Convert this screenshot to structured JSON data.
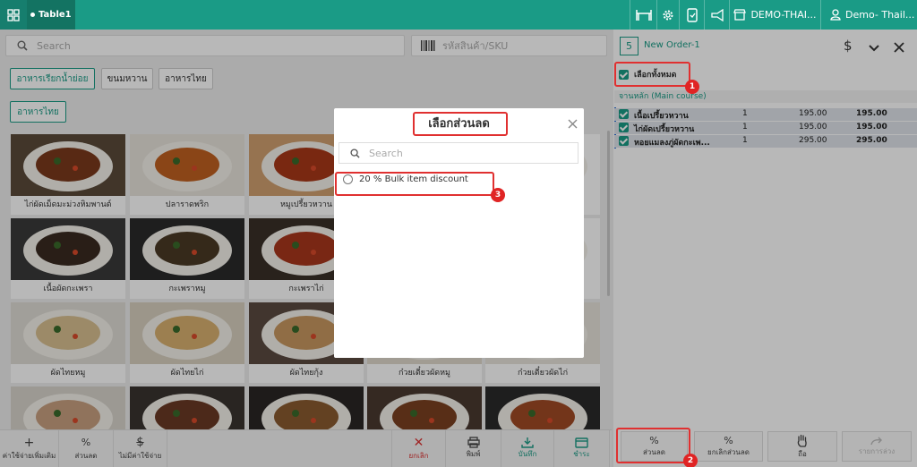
{
  "topbar": {
    "table_tab": "Table1",
    "branch": "DEMO-THAI...",
    "user": "Demo- Thail..."
  },
  "search": {
    "placeholder": "Search"
  },
  "sku": {
    "placeholder": "รหัสสินค้า/SKU"
  },
  "categories": [
    "อาหารเรียกน้ำย่อย",
    "ขนมหวาน",
    "อาหารไทย",
    "อาหารไทย"
  ],
  "products": [
    "ไก่ผัดเม็ดมะม่วงหิมพานต์",
    "ปลาราดพริก",
    "หมูเปรี้ยวหวาน",
    "",
    "",
    "เนื้อผัดกะเพรา",
    "กะเพราหมู",
    "กะเพราไก่",
    "",
    "",
    "ผัดไทยหมู",
    "ผัดไทยไก่",
    "ผัดไทยกุ้ง",
    "ก๋วยเตี๋ยวผัดหมู",
    "ก๋วยเตี๋ยวผัดไก่",
    "",
    "",
    "",
    "",
    ""
  ],
  "bottom_left": {
    "extra_charge": "ค่าใช้จ่ายเพิ่มเติม",
    "discount": "ส่วนลด",
    "no_charge": "ไม่มีค่าใช้จ่าย",
    "cancel": "ยกเลิก",
    "print": "พิมพ์",
    "save": "บันทึก",
    "pay": "ชำระ"
  },
  "order": {
    "number": "5",
    "title": "New Order-1",
    "select_all": "เลือกทั้งหมด",
    "section": "จานหลัก (Main course)",
    "items": [
      {
        "name": "เนื้อเปรี้ยวหวาน",
        "qty": "1",
        "price": "195.00",
        "total": "195.00"
      },
      {
        "name": "ไก่ผัดเปรี้ยวหวาน",
        "qty": "1",
        "price": "195.00",
        "total": "195.00"
      },
      {
        "name": "หอยแมลงภู่ผัดกะเพ...",
        "qty": "1",
        "price": "295.00",
        "total": "295.00"
      }
    ]
  },
  "bottom_right": {
    "discount": "ส่วนลด",
    "cancel_discount": "ยกเลิกส่วนลด",
    "hold": "ถือ",
    "undo": "รายการล่วง"
  },
  "modal": {
    "title": "เลือกส่วนลด",
    "search_placeholder": "Search",
    "options": [
      "20 % Bulk item discount"
    ]
  },
  "badges": [
    "1",
    "2",
    "3"
  ],
  "colors": {
    "accent": "#1a9b86",
    "highlight": "#e03030"
  }
}
